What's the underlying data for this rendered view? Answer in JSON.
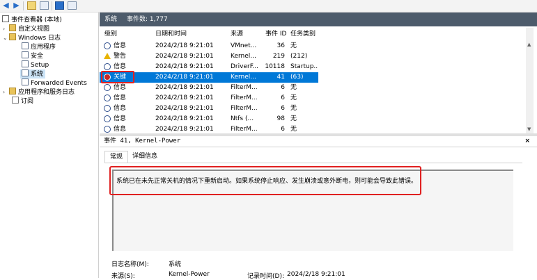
{
  "tree": {
    "root_label": "事件查看器 (本地)",
    "items": [
      {
        "label": "自定义视图",
        "expander": "›"
      },
      {
        "label": "Windows 日志",
        "expander": "⌄"
      },
      {
        "label": "应用程序"
      },
      {
        "label": "安全"
      },
      {
        "label": "Setup"
      },
      {
        "label": "系统",
        "selected": true
      },
      {
        "label": "Forwarded Events"
      },
      {
        "label": "应用程序和服务日志",
        "expander": "›"
      },
      {
        "label": "订阅"
      }
    ]
  },
  "header": {
    "title": "系统",
    "count": "事件数: 1,777"
  },
  "grid": {
    "columns": [
      "级别",
      "日期和时间",
      "来源",
      "事件 ID",
      "任务类别"
    ],
    "rows": [
      {
        "level": "信息",
        "icon": "info",
        "datetime": "2024/2/18 9:21:01",
        "source": "VMnet...",
        "id": "36",
        "task": "无"
      },
      {
        "level": "警告",
        "icon": "warning",
        "datetime": "2024/2/18 9:21:01",
        "source": "Kernel...",
        "id": "219",
        "task": "(212)"
      },
      {
        "level": "信息",
        "icon": "info",
        "datetime": "2024/2/18 9:21:01",
        "source": "DriverF...",
        "id": "10118",
        "task": "Startup..."
      },
      {
        "level": "关键",
        "icon": "critical",
        "datetime": "2024/2/18 9:21:01",
        "source": "Kernel...",
        "id": "41",
        "task": "(63)",
        "selected": true
      },
      {
        "level": "信息",
        "icon": "info",
        "datetime": "2024/2/18 9:21:01",
        "source": "FilterM...",
        "id": "6",
        "task": "无"
      },
      {
        "level": "信息",
        "icon": "info",
        "datetime": "2024/2/18 9:21:01",
        "source": "FilterM...",
        "id": "6",
        "task": "无"
      },
      {
        "level": "信息",
        "icon": "info",
        "datetime": "2024/2/18 9:21:01",
        "source": "FilterM...",
        "id": "6",
        "task": "无"
      },
      {
        "level": "信息",
        "icon": "info",
        "datetime": "2024/2/18 9:21:01",
        "source": "Ntfs (...",
        "id": "98",
        "task": "无"
      },
      {
        "level": "信息",
        "icon": "info",
        "datetime": "2024/2/18 9:21:01",
        "source": "FilterM...",
        "id": "6",
        "task": "无"
      }
    ]
  },
  "detail": {
    "title": "事件 41, Kernel-Power",
    "close": "×",
    "tabs": [
      "常规",
      "详细信息"
    ],
    "description": "系统已在未先正常关机的情况下重新启动。如果系统停止响应、发生崩溃或意外断电，则可能会导致此错误。",
    "log_name_label": "日志名称(M):",
    "log_name_value": "系统",
    "source_label": "来源(S):",
    "source_value": "Kernel-Power",
    "logged_label": "记录时间(D):",
    "logged_value": "2024/2/18 9:21:01"
  },
  "colors": {
    "header_bg": "#4d5b6b",
    "selection": "#0078d7",
    "highlight_box": "#e02020"
  }
}
